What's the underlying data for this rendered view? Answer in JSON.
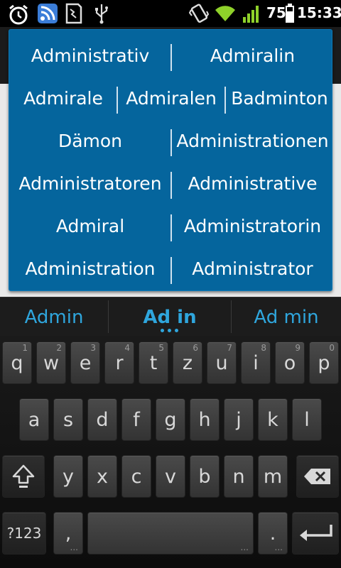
{
  "status_bar": {
    "battery_percent": "75",
    "time": "15:33",
    "icons": [
      "alarm-icon",
      "rss-feed-icon",
      "sd-card-icon",
      "usb-icon",
      "vibrate-icon",
      "wifi-icon",
      "signal-icon",
      "battery-icon"
    ]
  },
  "popup": {
    "rows": [
      [
        "Administrativ",
        "Admiralin"
      ],
      [
        "Admirale",
        "Admiralen",
        "Badminton"
      ],
      [
        "Dämon",
        "Administrationen"
      ],
      [
        "Administratoren",
        "Administrative"
      ],
      [
        "Admiral",
        "Administratorin"
      ],
      [
        "Administration",
        "Administrator"
      ]
    ]
  },
  "suggestions": {
    "left": "Admin",
    "center": "Ad in",
    "right": "Ad min"
  },
  "keyboard": {
    "row1": [
      {
        "label": "q",
        "hint": "1"
      },
      {
        "label": "w",
        "hint": "2"
      },
      {
        "label": "e",
        "hint": "3"
      },
      {
        "label": "r",
        "hint": "4"
      },
      {
        "label": "t",
        "hint": "5"
      },
      {
        "label": "z",
        "hint": "6"
      },
      {
        "label": "u",
        "hint": "7"
      },
      {
        "label": "i",
        "hint": "8"
      },
      {
        "label": "o",
        "hint": "9"
      },
      {
        "label": "p",
        "hint": "0"
      }
    ],
    "row2": [
      "a",
      "s",
      "d",
      "f",
      "g",
      "h",
      "j",
      "k",
      "l"
    ],
    "row3": [
      "y",
      "x",
      "c",
      "v",
      "b",
      "n",
      "m"
    ],
    "symbols_label": "?123",
    "comma_label": ",",
    "period_label": ".",
    "ellipsis": "..."
  }
}
